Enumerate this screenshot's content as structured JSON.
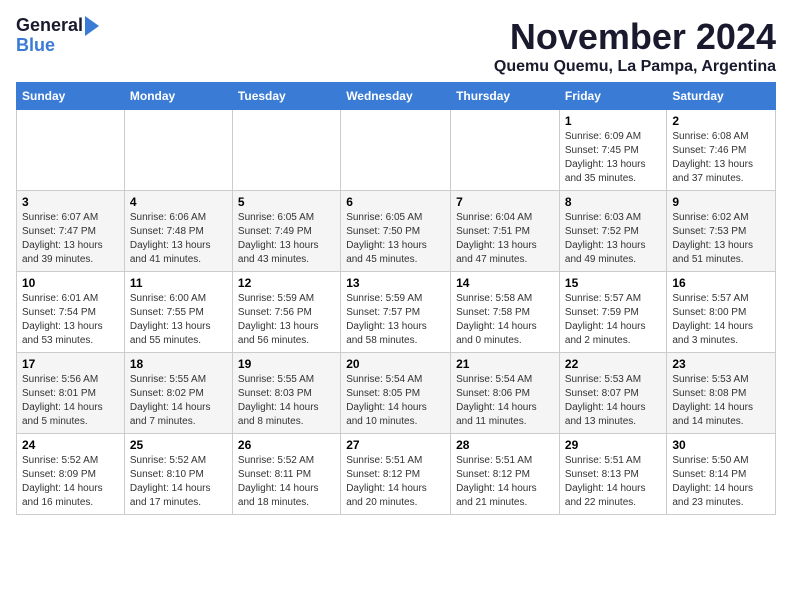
{
  "header": {
    "logo_line1": "General",
    "logo_line2": "Blue",
    "month": "November 2024",
    "location": "Quemu Quemu, La Pampa, Argentina"
  },
  "days_of_week": [
    "Sunday",
    "Monday",
    "Tuesday",
    "Wednesday",
    "Thursday",
    "Friday",
    "Saturday"
  ],
  "weeks": [
    [
      {
        "day": "",
        "detail": ""
      },
      {
        "day": "",
        "detail": ""
      },
      {
        "day": "",
        "detail": ""
      },
      {
        "day": "",
        "detail": ""
      },
      {
        "day": "",
        "detail": ""
      },
      {
        "day": "1",
        "detail": "Sunrise: 6:09 AM\nSunset: 7:45 PM\nDaylight: 13 hours\nand 35 minutes."
      },
      {
        "day": "2",
        "detail": "Sunrise: 6:08 AM\nSunset: 7:46 PM\nDaylight: 13 hours\nand 37 minutes."
      }
    ],
    [
      {
        "day": "3",
        "detail": "Sunrise: 6:07 AM\nSunset: 7:47 PM\nDaylight: 13 hours\nand 39 minutes."
      },
      {
        "day": "4",
        "detail": "Sunrise: 6:06 AM\nSunset: 7:48 PM\nDaylight: 13 hours\nand 41 minutes."
      },
      {
        "day": "5",
        "detail": "Sunrise: 6:05 AM\nSunset: 7:49 PM\nDaylight: 13 hours\nand 43 minutes."
      },
      {
        "day": "6",
        "detail": "Sunrise: 6:05 AM\nSunset: 7:50 PM\nDaylight: 13 hours\nand 45 minutes."
      },
      {
        "day": "7",
        "detail": "Sunrise: 6:04 AM\nSunset: 7:51 PM\nDaylight: 13 hours\nand 47 minutes."
      },
      {
        "day": "8",
        "detail": "Sunrise: 6:03 AM\nSunset: 7:52 PM\nDaylight: 13 hours\nand 49 minutes."
      },
      {
        "day": "9",
        "detail": "Sunrise: 6:02 AM\nSunset: 7:53 PM\nDaylight: 13 hours\nand 51 minutes."
      }
    ],
    [
      {
        "day": "10",
        "detail": "Sunrise: 6:01 AM\nSunset: 7:54 PM\nDaylight: 13 hours\nand 53 minutes."
      },
      {
        "day": "11",
        "detail": "Sunrise: 6:00 AM\nSunset: 7:55 PM\nDaylight: 13 hours\nand 55 minutes."
      },
      {
        "day": "12",
        "detail": "Sunrise: 5:59 AM\nSunset: 7:56 PM\nDaylight: 13 hours\nand 56 minutes."
      },
      {
        "day": "13",
        "detail": "Sunrise: 5:59 AM\nSunset: 7:57 PM\nDaylight: 13 hours\nand 58 minutes."
      },
      {
        "day": "14",
        "detail": "Sunrise: 5:58 AM\nSunset: 7:58 PM\nDaylight: 14 hours\nand 0 minutes."
      },
      {
        "day": "15",
        "detail": "Sunrise: 5:57 AM\nSunset: 7:59 PM\nDaylight: 14 hours\nand 2 minutes."
      },
      {
        "day": "16",
        "detail": "Sunrise: 5:57 AM\nSunset: 8:00 PM\nDaylight: 14 hours\nand 3 minutes."
      }
    ],
    [
      {
        "day": "17",
        "detail": "Sunrise: 5:56 AM\nSunset: 8:01 PM\nDaylight: 14 hours\nand 5 minutes."
      },
      {
        "day": "18",
        "detail": "Sunrise: 5:55 AM\nSunset: 8:02 PM\nDaylight: 14 hours\nand 7 minutes."
      },
      {
        "day": "19",
        "detail": "Sunrise: 5:55 AM\nSunset: 8:03 PM\nDaylight: 14 hours\nand 8 minutes."
      },
      {
        "day": "20",
        "detail": "Sunrise: 5:54 AM\nSunset: 8:05 PM\nDaylight: 14 hours\nand 10 minutes."
      },
      {
        "day": "21",
        "detail": "Sunrise: 5:54 AM\nSunset: 8:06 PM\nDaylight: 14 hours\nand 11 minutes."
      },
      {
        "day": "22",
        "detail": "Sunrise: 5:53 AM\nSunset: 8:07 PM\nDaylight: 14 hours\nand 13 minutes."
      },
      {
        "day": "23",
        "detail": "Sunrise: 5:53 AM\nSunset: 8:08 PM\nDaylight: 14 hours\nand 14 minutes."
      }
    ],
    [
      {
        "day": "24",
        "detail": "Sunrise: 5:52 AM\nSunset: 8:09 PM\nDaylight: 14 hours\nand 16 minutes."
      },
      {
        "day": "25",
        "detail": "Sunrise: 5:52 AM\nSunset: 8:10 PM\nDaylight: 14 hours\nand 17 minutes."
      },
      {
        "day": "26",
        "detail": "Sunrise: 5:52 AM\nSunset: 8:11 PM\nDaylight: 14 hours\nand 18 minutes."
      },
      {
        "day": "27",
        "detail": "Sunrise: 5:51 AM\nSunset: 8:12 PM\nDaylight: 14 hours\nand 20 minutes."
      },
      {
        "day": "28",
        "detail": "Sunrise: 5:51 AM\nSunset: 8:12 PM\nDaylight: 14 hours\nand 21 minutes."
      },
      {
        "day": "29",
        "detail": "Sunrise: 5:51 AM\nSunset: 8:13 PM\nDaylight: 14 hours\nand 22 minutes."
      },
      {
        "day": "30",
        "detail": "Sunrise: 5:50 AM\nSunset: 8:14 PM\nDaylight: 14 hours\nand 23 minutes."
      }
    ]
  ]
}
